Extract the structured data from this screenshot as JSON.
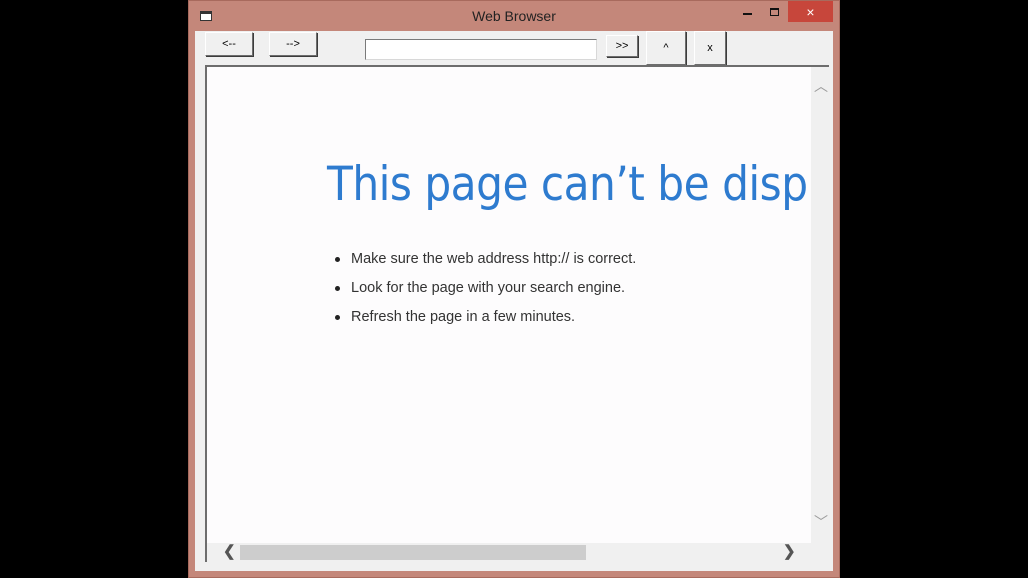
{
  "window": {
    "title": "Web Browser",
    "minimize_label": "",
    "maximize_label": "",
    "close_label": "×"
  },
  "toolbar": {
    "back_label": "<--",
    "forward_label": "-->",
    "address_value": "",
    "go_label": ">>",
    "up_label": "^",
    "stop_label": "x"
  },
  "page": {
    "heading": "This page can’t be displayed",
    "tips": [
      "Make sure the web address http:// is correct.",
      "Look for the page with your search engine.",
      "Refresh the page in a few minutes."
    ]
  },
  "scrollbars": {
    "vertical_up": "︿",
    "vertical_down": "﹀",
    "horizontal_left": "❮",
    "horizontal_right": "❯"
  },
  "colors": {
    "window_frame": "#c4877a",
    "close_button": "#c7463b",
    "heading_blue": "#2e7bcf"
  }
}
